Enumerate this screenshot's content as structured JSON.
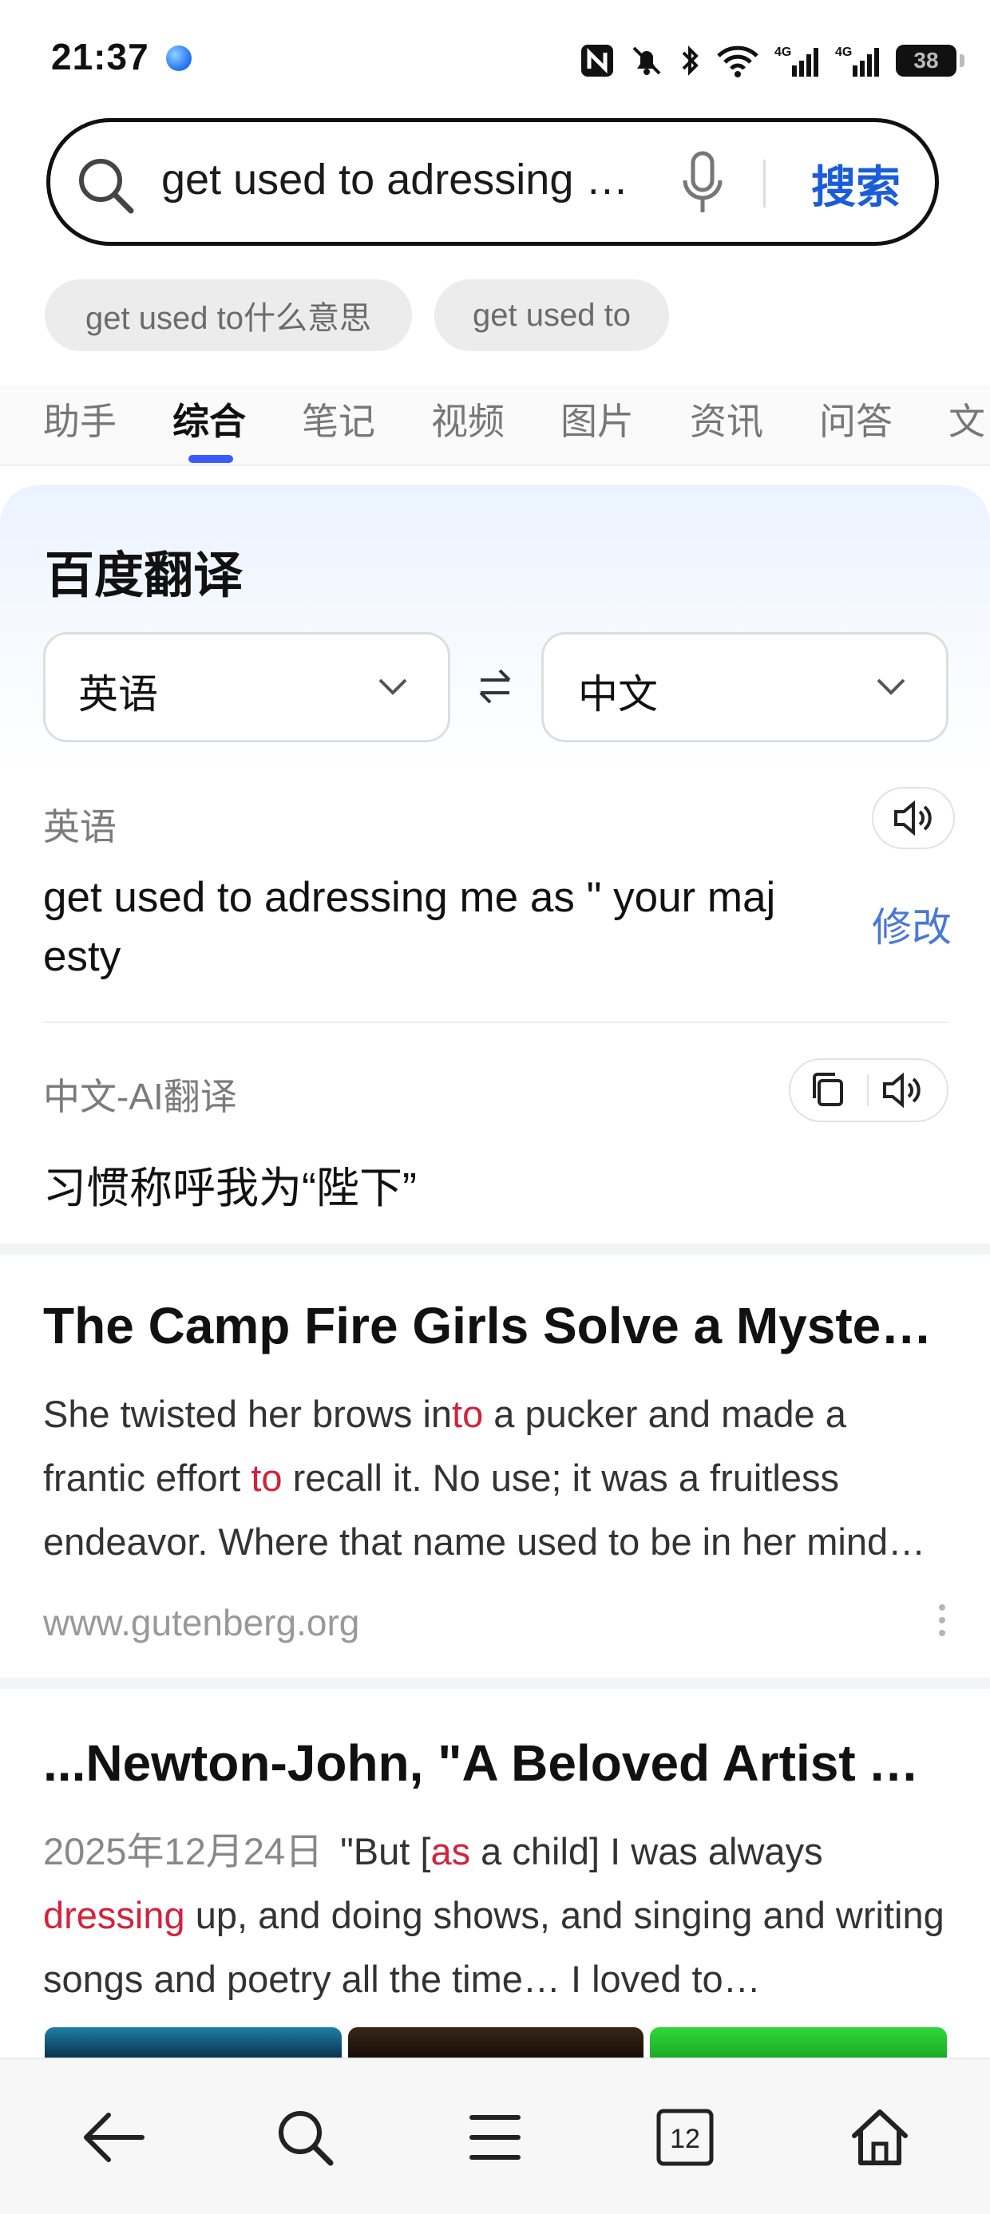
{
  "status_bar": {
    "time": "21:37",
    "icons": [
      "nfc-icon",
      "mute-bell-icon",
      "bluetooth-icon",
      "wifi-icon",
      "signal-4g-icon",
      "signal-4g-icon"
    ],
    "battery": "38"
  },
  "search": {
    "query": "get used to adressing …",
    "button": "搜索"
  },
  "suggestions": [
    "get used to什么意思",
    "get used to"
  ],
  "tabs": [
    "助手",
    "综合",
    "笔记",
    "视频",
    "图片",
    "资讯",
    "问答",
    "文"
  ],
  "active_tab": "综合",
  "translate_card": {
    "title": "百度翻译",
    "source_lang": "英语",
    "target_lang": "中文",
    "source_label": "英语",
    "source_text": "get used to adressing me as \" your majesty",
    "edit_label": "修改",
    "target_label": "中文-AI翻译",
    "target_text": "习惯称呼我为“陛下”"
  },
  "results": [
    {
      "title": "The Camp Fire Girls Solve a Mystery, b…",
      "snippet": {
        "s1": "She twisted her brows in",
        "h1": "to",
        "s2": " a pucker and made a frantic effort ",
        "h2": "to",
        "s3": " recall it. No use; it was a fruitless endeavor. Where that name used to be in her mind…"
      },
      "site": "www.gutenberg.org"
    },
    {
      "title": "...Newton-John, \"A Beloved Artist And …",
      "snippet": {
        "date": "2025年12月24日",
        "s1": "\"But [",
        "h1": "as",
        "s2": " a child] I was always ",
        "h2": "dressing",
        "s3": " up, and doing shows, and singing and writing songs and poetry all the time… I loved to…"
      }
    }
  ],
  "bottom_nav": {
    "tab_count": "12",
    "icons": [
      "back-arrow-icon",
      "search-icon",
      "menu-icon",
      "tabs-icon",
      "home-icon"
    ]
  },
  "colors": {
    "accent": "#1a5dd8",
    "highlight": "#d4223b",
    "tab_indicator": "#3a5bff"
  }
}
